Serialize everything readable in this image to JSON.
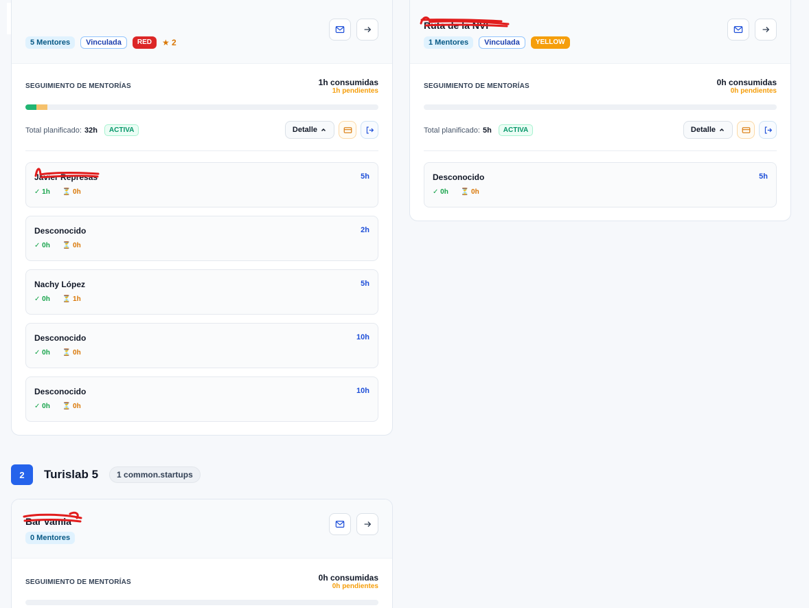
{
  "icons": {
    "mail": "envelope-icon",
    "arrow": "arrow-right-icon",
    "card": "credit-card-icon",
    "exit": "log-out-icon",
    "chevron": "chevron-up-icon",
    "done": "check-icon",
    "pending": "hourglass-icon"
  },
  "colors": {
    "accent": "#2563eb",
    "done": "#16a34a",
    "pending": "#f59e0b",
    "red_badge": "#dc2626",
    "yellow_badge": "#f59e0b"
  },
  "cards": [
    {
      "title": "",
      "mentors_badge": "5 Mentores",
      "linked_badge": "Vinculada",
      "status_badge": "RED",
      "rating": "★ 2",
      "tracking_title": "SEGUIMIENTO DE MENTORÍAS",
      "consumed": "1h consumidas",
      "pending": "1h pendientes",
      "progress": {
        "done": 1,
        "pending": 1,
        "total": 32
      },
      "total_label": "Total planificado:",
      "total_value": "32h",
      "state": "ACTIVA",
      "detail_label": "Detalle",
      "mentors": [
        {
          "name": "Javier Represas",
          "hours": "5h",
          "done": "✓ 1h",
          "pending": "⏳ 0h"
        },
        {
          "name": "Desconocido",
          "hours": "2h",
          "done": "✓ 0h",
          "pending": "⏳ 0h"
        },
        {
          "name": "Nachy López",
          "hours": "5h",
          "done": "✓ 0h",
          "pending": "⏳ 1h"
        },
        {
          "name": "Desconocido",
          "hours": "10h",
          "done": "✓ 0h",
          "pending": "⏳ 0h"
        },
        {
          "name": "Desconocido",
          "hours": "10h",
          "done": "✓ 0h",
          "pending": "⏳ 0h"
        }
      ]
    },
    {
      "title": "Ruta de la NVI",
      "mentors_badge": "1 Mentores",
      "linked_badge": "Vinculada",
      "status_badge": "YELLOW",
      "tracking_title": "SEGUIMIENTO DE MENTORÍAS",
      "consumed": "0h consumidas",
      "pending": "0h pendientes",
      "progress": {
        "done": 0,
        "pending": 0,
        "total": 5
      },
      "total_label": "Total planificado:",
      "total_value": "5h",
      "state": "ACTIVA",
      "detail_label": "Detalle",
      "mentors": [
        {
          "name": "Desconocido",
          "hours": "5h",
          "done": "✓ 0h",
          "pending": "⏳ 0h"
        }
      ]
    },
    {
      "title": "Bar vamia",
      "mentors_badge": "0 Mentores",
      "tracking_title": "SEGUIMIENTO DE MENTORÍAS",
      "consumed": "0h consumidas",
      "pending": "0h pendientes"
    }
  ],
  "group": {
    "number": "2",
    "name": "Turislab 5",
    "pill": "1 common.startups"
  }
}
